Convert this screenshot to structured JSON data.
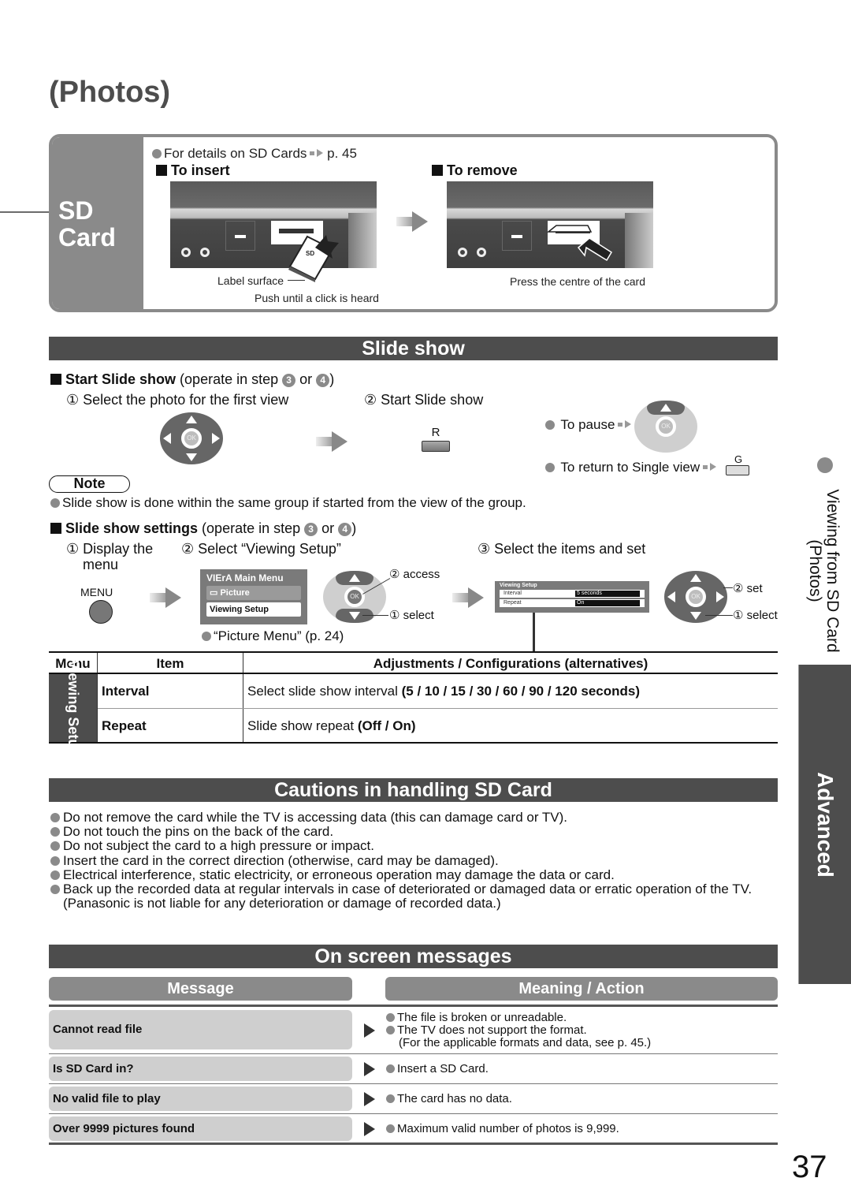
{
  "page": {
    "title": "(Photos)",
    "page_number": "37"
  },
  "sd_card": {
    "side_label_line1": "SD",
    "side_label_line2": "Card",
    "details_text": "For details on SD Cards",
    "details_ref": "p. 45",
    "insert": {
      "heading": "To insert",
      "caption_label_surface": "Label surface",
      "caption_push": "Push until a click is heard"
    },
    "remove": {
      "heading": "To remove",
      "caption": "Press the centre of the card"
    }
  },
  "slide_show": {
    "bar_title": "Slide show",
    "start": {
      "heading_bold": "Start Slide show",
      "heading_rest": "(operate in step",
      "step_a": "3",
      "or": "or",
      "step_b": "4",
      "close": ")",
      "step1": "① Select the photo for the first view",
      "step2": "② Start Slide show",
      "button_r": "R",
      "ok_label": "OK",
      "to_pause": "To pause",
      "to_return": "To return to Single view",
      "button_g": "G"
    },
    "note": {
      "label": "Note",
      "text": "Slide show is done within the same group if started from the view of the group."
    },
    "settings": {
      "heading_bold": "Slide show settings",
      "heading_rest": "(operate in step",
      "step_a": "3",
      "or": "or",
      "step_b": "4",
      "close": ")",
      "step1_line1": "① Display the",
      "step1_line2": "menu",
      "step2": "② Select “Viewing Setup”",
      "step3": "③ Select the items and set",
      "menu_button": "MENU",
      "main_menu": {
        "header": "VIErA Main Menu",
        "item_picture": "Picture",
        "item_viewing_setup": "Viewing Setup"
      },
      "access_label": "② access",
      "select_label": "① select",
      "set_label": "② set",
      "select_label2": "① select",
      "picture_menu_ref": "“Picture Menu” (p. 24)",
      "viewing_setup_menu": {
        "header": "Viewing Setup",
        "rows": [
          {
            "label": "Interval",
            "value": "5 seconds"
          },
          {
            "label": "Repeat",
            "value": "On"
          }
        ]
      }
    },
    "table": {
      "headers": [
        "Menu",
        "Item",
        "Adjustments / Configurations (alternatives)"
      ],
      "menu_group": "Viewing Setup",
      "rows": [
        {
          "item": "Interval",
          "desc": "Select slide show interval",
          "options": "(5 / 10 / 15 / 30 / 60 / 90 / 120 seconds)"
        },
        {
          "item": "Repeat",
          "desc": "Slide show repeat",
          "options": "(Off / On)"
        }
      ]
    }
  },
  "cautions": {
    "bar_title": "Cautions in handling SD Card",
    "items": [
      "Do not remove the card while the TV is accessing data (this can damage card or TV).",
      "Do not touch the pins on the back of the card.",
      "Do not subject the card to a high pressure or impact.",
      "Insert the card in the correct direction (otherwise, card may be damaged).",
      "Electrical interference, static electricity, or erroneous operation may damage the data or card.",
      "Back up the recorded data at regular intervals in case of deteriorated or damaged data or erratic operation of the TV. (Panasonic is not liable for any deterioration or damage of recorded data.)"
    ]
  },
  "messages": {
    "bar_title": "On screen messages",
    "col_message": "Message",
    "col_meaning": "Meaning / Action",
    "rows": [
      {
        "message": "Cannot read file",
        "lines": [
          "The file is broken or unreadable.",
          "The TV does not support the format.",
          "(For the applicable formats and data, see p. 45.)"
        ]
      },
      {
        "message": "Is SD Card in?",
        "lines": [
          "Insert a SD Card."
        ]
      },
      {
        "message": "No valid file to play",
        "lines": [
          "The card has no data."
        ]
      },
      {
        "message": "Over 9999 pictures found",
        "lines": [
          "Maximum valid number of photos is 9,999."
        ]
      }
    ]
  },
  "side_tab": {
    "section_line1": "Viewing from SD Card",
    "section_line2": "(Photos)",
    "chapter": "Advanced"
  },
  "colors": {
    "bar_dark": "#4d4d4d",
    "accent_grey": "#8a8a8a",
    "cell_light": "#cfcfcf"
  }
}
